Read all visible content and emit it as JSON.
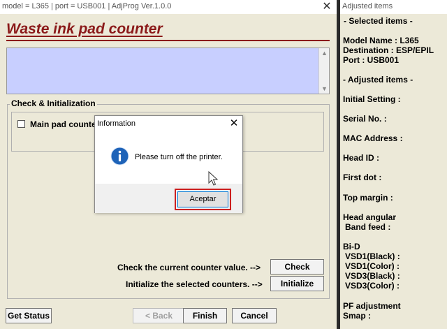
{
  "main_window": {
    "title": "model = L365 | port = USB001 | AdjProg Ver.1.0.0",
    "close_glyph": "✕",
    "header": "Waste ink pad counter",
    "group_label": "Check & Initialization",
    "main_pad_label": "Main pad counter",
    "check_label": "Check the current counter value. -->",
    "check_button": "Check",
    "initialize_label": "Initialize the selected counters. -->",
    "initialize_button": "Initialize",
    "get_status_button": "Get Status",
    "back_button": "< Back",
    "finish_button": "Finish",
    "cancel_button": "Cancel"
  },
  "dialog": {
    "title": "Information",
    "close_glyph": "✕",
    "message": "Please turn off the printer.",
    "ok_button": "Aceptar",
    "icon": "info-icon"
  },
  "side_panel": {
    "title": "Adjusted items",
    "selected_header": "- Selected items -",
    "model_name": "Model Name : L365",
    "destination": "Destination : ESP/EPIL",
    "port": "Port : USB001",
    "adjusted_header": "- Adjusted items -",
    "initial_setting": "Initial Setting :",
    "serial_no": "Serial No. :",
    "mac_address": "MAC Address :",
    "head_id": "Head ID :",
    "first_dot": "First dot :",
    "top_margin": "Top margin :",
    "head_angular": "Head angular",
    "band_feed": "Band feed :",
    "bi_d": "Bi-D",
    "vsd1_black": "VSD1(Black) :",
    "vsd1_color": "VSD1(Color) :",
    "vsd3_black": "VSD3(Black) :",
    "vsd3_color": "VSD3(Color) :",
    "pf_adjustment": "PF adjustment",
    "smap": "Smap :"
  },
  "colors": {
    "header": "#8b1a1a",
    "message_area": "#c8cfff",
    "highlight": "#cc1f1f",
    "info_icon": "#1e63b8"
  }
}
